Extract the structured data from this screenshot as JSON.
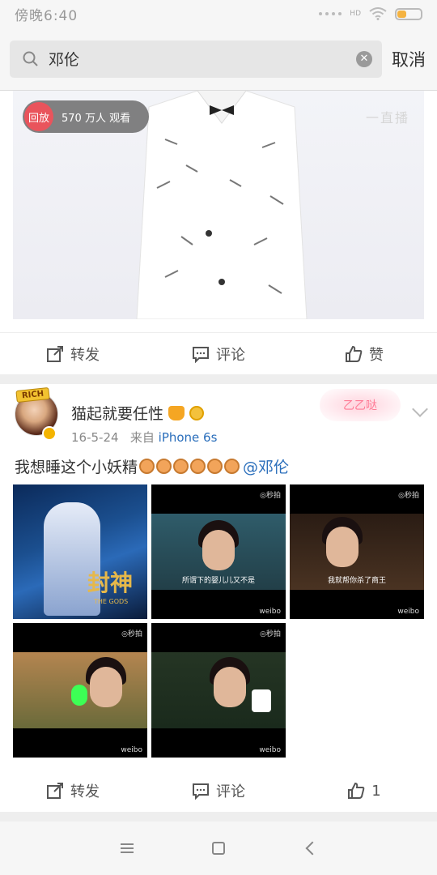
{
  "status_bar": {
    "time": "傍晚6:40",
    "network": "HD"
  },
  "search": {
    "query": "邓伦",
    "cancel_label": "取消"
  },
  "video_card": {
    "replay_tag": "回放",
    "viewers": "570 万人 观看",
    "live_logo": "一直播",
    "actions": {
      "repost": "转发",
      "comment": "评论",
      "like": "赞"
    }
  },
  "post": {
    "badge": "RICH",
    "username": "猫起就要任性",
    "date": "16-5-24",
    "source_prefix": "来自",
    "source": "iPhone 6s",
    "deco_text": "乙乙哒",
    "text": "我想睡这个小妖精",
    "emoji_count": 6,
    "mention": "@邓伦",
    "thumbnails": [
      {
        "label": "封神",
        "sublabel": "THE GODS",
        "watermark": "",
        "miaopai": ""
      },
      {
        "label": "",
        "subtitle": "所谓下的婴儿儿又不是",
        "watermark": "weibo",
        "miaopai": "◎秒拍"
      },
      {
        "label": "",
        "subtitle": "我就帮你杀了商王",
        "watermark": "weibo",
        "miaopai": "◎秒拍"
      },
      {
        "label": "",
        "subtitle": "",
        "watermark": "weibo",
        "miaopai": "◎秒拍"
      },
      {
        "label": "",
        "subtitle": "",
        "watermark": "weibo",
        "miaopai": "◎秒拍"
      }
    ],
    "actions": {
      "repost": "转发",
      "comment": "评论",
      "like_count": "1"
    }
  },
  "colors": {
    "link": "#2a6ebb",
    "replay_red": "#e9545c",
    "background": "#eeeeee"
  }
}
